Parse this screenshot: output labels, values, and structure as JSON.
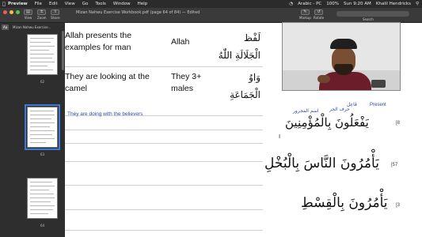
{
  "menubar": {
    "app_name": "Preview",
    "menus": [
      "File",
      "Edit",
      "View",
      "Go",
      "Tools",
      "Window",
      "Help"
    ],
    "status": {
      "input_source": "Arabic - PC",
      "battery": "100%",
      "clock": "Sun 9:20 AM",
      "user": "Khalil Hendricks"
    }
  },
  "toolbar": {
    "title": "Mizan Nahwu Exercise Workbook.pdf (page 64 of 84) — Edited",
    "tools": {
      "view": "View",
      "zoom": "Zoom",
      "share": "Share",
      "markup": "Markup",
      "rotate": "Rotate",
      "search": "Search"
    }
  },
  "sidebar": {
    "tabs": [
      "Aa",
      "Mizan Nahwu Exercise..."
    ],
    "pages": [
      {
        "label": "62"
      },
      {
        "label": "63"
      },
      {
        "label": "64"
      }
    ]
  },
  "document": {
    "rows": [
      {
        "english": "Allah presents the\nexamples for man",
        "word": "Allah",
        "arabic": "لَفْظ\nالْجَلَالَةِ اللّٰهُ"
      },
      {
        "english": "They are looking at the\ncamel",
        "word": "They 3+\nmales",
        "arabic": "وَاوُ\nالْجَمَاعَةِ"
      }
    ],
    "note": "They are doing with the believers",
    "annotations": {
      "present": "Present",
      "faail": "فَاعِل",
      "harf_jar": "حرف الجر",
      "ism_majrur": "اسم المجرور"
    },
    "verses": [
      {
        "text": "يَفْعَلُونَ بِالْمُؤْمِنِينَ",
        "number": "[8"
      },
      {
        "text": "يَأْمُرُونَ النَّاسَ بِالْبُخْلِ",
        "number": "[57"
      },
      {
        "text": "يَأْمُرُونَ بِالْقِسْطِ",
        "number": "[3"
      }
    ]
  }
}
